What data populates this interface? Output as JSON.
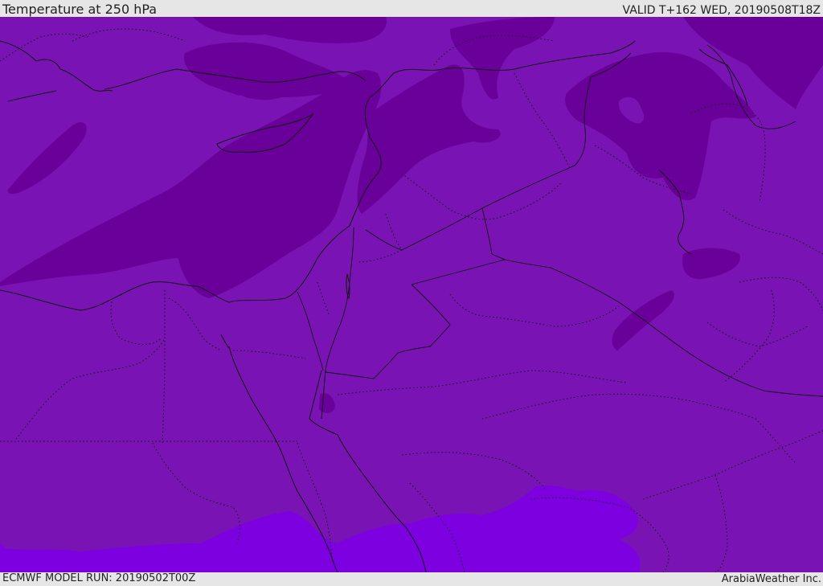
{
  "header": {
    "title": "Temperature at 250 hPa",
    "valid_time": "VALID T+162 WED, 20190508T18Z"
  },
  "footer": {
    "model_run": "ECMWF MODEL RUN: 20190502T00Z",
    "credit": "ArabiaWeather Inc."
  },
  "map": {
    "colors": {
      "base_fill": "#7a13b3",
      "cold_band": "#690099",
      "warm_band": "#7c00e0",
      "coastline": "#111111",
      "borders_dotted": "#111111"
    }
  }
}
